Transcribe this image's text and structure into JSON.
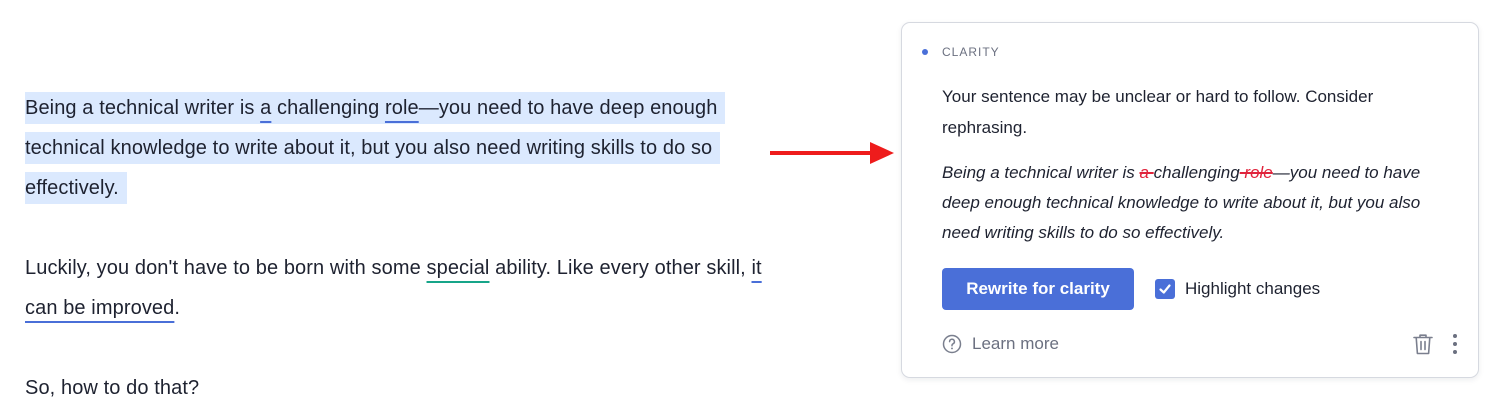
{
  "editor": {
    "paragraph1": {
      "t1": "Being a technical writer is ",
      "u1": "a",
      "t2": " challenging ",
      "u2": "role",
      "t3": "—you need to have deep enough technical knowledge to write about it, but you also need writing skills to do so effectively."
    },
    "paragraph2": {
      "t1": "Luckily, you don't have to be born with some ",
      "u1": "special",
      "t2": " ability. Like every other skill, ",
      "u2": "it can be improved",
      "t3": "."
    },
    "paragraph3": "So, how to do that?"
  },
  "card": {
    "category": "CLARITY",
    "message": "Your sentence may be unclear or hard to follow. Consider rephrasing.",
    "preview": {
      "t1": "Being a technical writer is ",
      "del1": "a ",
      "t2": "challenging",
      "del2": " role",
      "t3": "—you need to have deep enough technical knowledge to write about it, but you also need writing skills to do so effectively."
    },
    "primary_button": "Rewrite for clarity",
    "checkbox_label": "Highlight changes",
    "checkbox_checked": true,
    "learn_more": "Learn more"
  },
  "icons": {
    "help": "question-circle-icon",
    "trash": "trash-icon",
    "more": "more-vertical-icon",
    "check": "check-icon"
  },
  "colors": {
    "accent": "#4a6fd8",
    "highlight": "#dbe9fe",
    "deletion": "#e0243c",
    "arrow": "#ee1c1c",
    "green_underline": "#17a589"
  }
}
